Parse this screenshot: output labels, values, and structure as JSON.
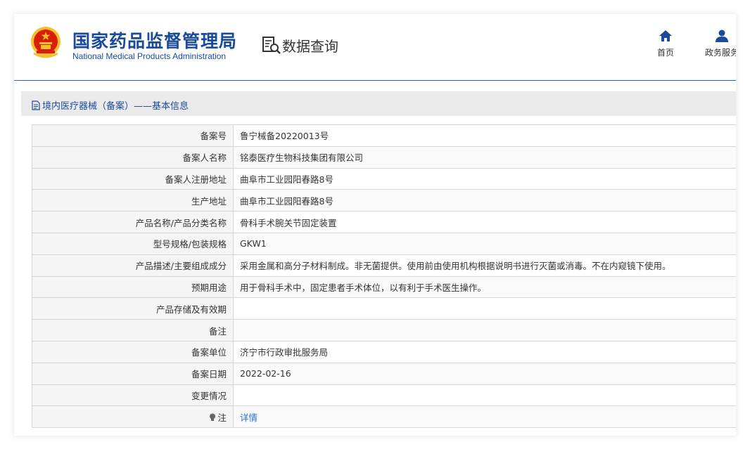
{
  "header": {
    "org_name_cn": "国家药品监督管理局",
    "org_name_en": "National Medical Products Administration",
    "query_title": "数据查询",
    "nav": [
      {
        "label": "首页",
        "icon": "home-icon"
      },
      {
        "label": "政务服务",
        "icon": "user-icon"
      }
    ]
  },
  "panel": {
    "title": "境内医疗器械（备案）——基本信息"
  },
  "rows": [
    {
      "label": "备案号",
      "value": "鲁宁械备20220013号"
    },
    {
      "label": "备案人名称",
      "value": "铭泰医疗生物科技集团有限公司"
    },
    {
      "label": "备案人注册地址",
      "value": "曲阜市工业园阳春路8号"
    },
    {
      "label": "生产地址",
      "value": "曲阜市工业园阳春路8号"
    },
    {
      "label": "产品名称/产品分类名称",
      "value": "骨科手术腕关节固定装置"
    },
    {
      "label": "型号规格/包装规格",
      "value": "GKW1"
    },
    {
      "label": "产品描述/主要组成成分",
      "value": "采用金属和高分子材料制成。非无菌提供。使用前由使用机构根据说明书进行灭菌或消毒。不在内窥镜下使用。"
    },
    {
      "label": "预期用途",
      "value": "用于骨科手术中，固定患者手术体位，以有利于手术医生操作。"
    },
    {
      "label": "产品存储及有效期",
      "value": ""
    },
    {
      "label": "备注",
      "value": ""
    },
    {
      "label": "备案单位",
      "value": "济宁市行政审批服务局"
    },
    {
      "label": "备案日期",
      "value": "2022-02-16"
    },
    {
      "label": "变更情况",
      "value": ""
    }
  ],
  "note_row": {
    "label": "注",
    "link_label": "详情"
  },
  "colors": {
    "brand_blue": "#1a4a9c",
    "link_blue": "#2a6fd6",
    "emblem_red": "#d81e06",
    "emblem_gold": "#f5c02c"
  }
}
